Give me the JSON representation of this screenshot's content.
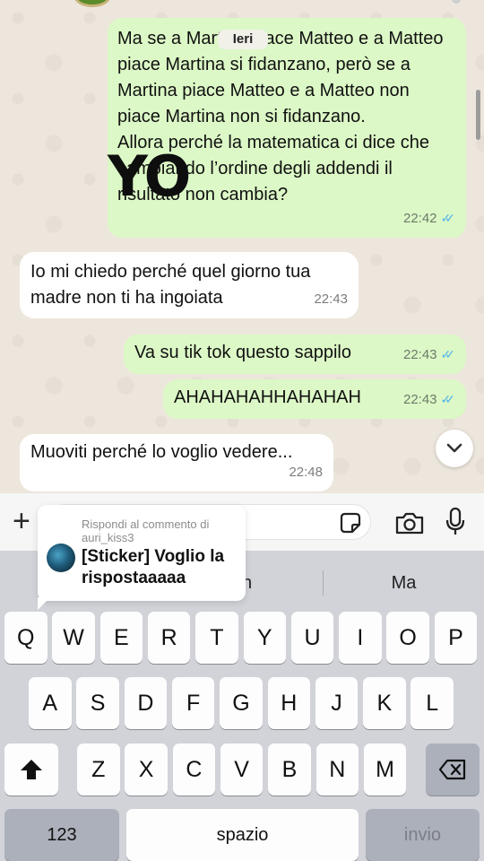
{
  "chat": {
    "day_label": "Ieri",
    "overlay_text": "YO",
    "messages": [
      {
        "direction": "out",
        "text": "Ma se a Martina piace Matteo e a Matteo piace Martina si fidanzano, però se a Martina piace Matteo e a Matteo non piace Martina non si fidanzano.\nAllora perché la matematica ci dice che cambiando l’ordine degli addendi il risultato non cambia?",
        "time": "22:42",
        "read": true
      },
      {
        "direction": "in",
        "text": "Io mi chiedo perché quel giorno tua madre non ti ha ingoiata",
        "time": "22:43"
      },
      {
        "direction": "out",
        "text": "Va su tik tok questo sappilo",
        "time": "22:43",
        "read": true
      },
      {
        "direction": "out",
        "text": "AHAHAHAHHAHAHAH",
        "time": "22:43",
        "read": true
      },
      {
        "direction": "in",
        "text": "Muoviti perché lo voglio vedere...",
        "time": "22:48"
      }
    ]
  },
  "comment": {
    "reply_to": "Rispondi al commento di auri_kiss3",
    "text": "[Sticker] Voglio la rispostaaaaa"
  },
  "keyboard": {
    "suggestions": [
      "on",
      "Ma"
    ],
    "row1": [
      "Q",
      "W",
      "E",
      "R",
      "T",
      "Y",
      "U",
      "I",
      "O",
      "P"
    ],
    "row2": [
      "A",
      "S",
      "D",
      "F",
      "G",
      "H",
      "J",
      "K",
      "L"
    ],
    "row3": [
      "Z",
      "X",
      "C",
      "V",
      "B",
      "N",
      "M"
    ],
    "numbers_label": "123",
    "space_label": "spazio",
    "return_label": "invio"
  },
  "icons": {
    "plus": "plus-icon",
    "sticker": "sticker-icon",
    "camera": "camera-icon",
    "mic": "microphone-icon",
    "shift": "shift-icon",
    "backspace": "backspace-icon",
    "scroll": "chevron-down-icon"
  },
  "colors": {
    "outgoing_bubble": "#dcf8c6",
    "incoming_bubble": "#ffffff",
    "read_ticks": "#4fb3e9",
    "keyboard_bg": "#d1d3d9"
  }
}
